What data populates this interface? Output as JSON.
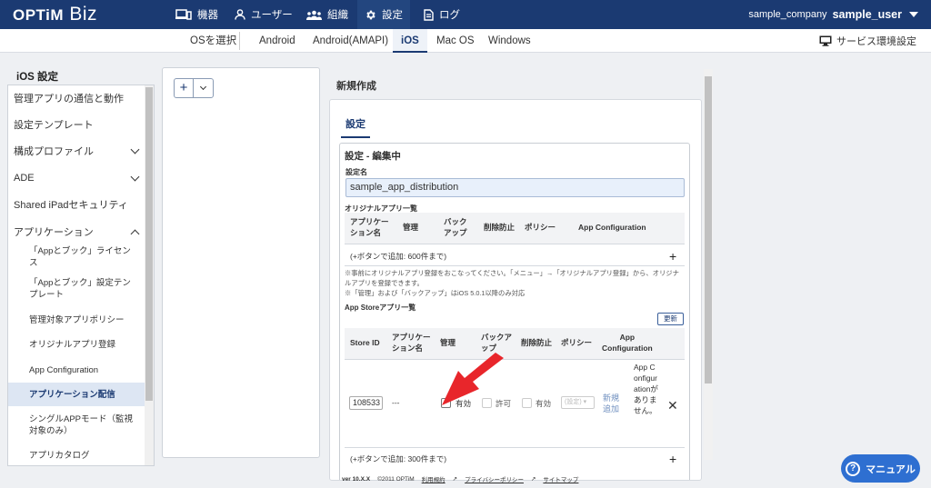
{
  "brand": {
    "logo_main": "OPTiM",
    "logo_sub": "Biz"
  },
  "topnav": [
    {
      "label": "機器",
      "icon": "device-icon"
    },
    {
      "label": "ユーザー",
      "icon": "user-icon"
    },
    {
      "label": "組織",
      "icon": "group-icon"
    },
    {
      "label": "設定",
      "icon": "gear-icon",
      "active": true
    },
    {
      "label": "ログ",
      "icon": "log-icon"
    }
  ],
  "account": {
    "company": "sample_company",
    "user": "sample_user"
  },
  "osbar": {
    "select_label": "OSを選択",
    "tabs": [
      "Android",
      "Android(AMAPI)",
      "iOS",
      "Mac OS",
      "Windows"
    ],
    "active_tab": "iOS",
    "service_settings": "サービス環境設定"
  },
  "sidebar": {
    "title": "iOS 設定",
    "items": [
      {
        "label": "管理アプリの通信と動作"
      },
      {
        "label": "設定テンプレート"
      },
      {
        "label": "構成プロファイル",
        "chevron": "down"
      },
      {
        "label": "ADE",
        "chevron": "down"
      },
      {
        "label": "Shared iPadセキュリティ"
      },
      {
        "label": "アプリケーション",
        "chevron": "up"
      },
      {
        "label": "「Appとブック」ライセンス"
      },
      {
        "label": "「Appとブック」設定テンプレート"
      },
      {
        "label": "管理対象アプリポリシー"
      },
      {
        "label": "オリジナルアプリ登録"
      },
      {
        "label": "App Configuration"
      },
      {
        "label": "アプリケーション配信",
        "active": true
      },
      {
        "label": "シングルAPPモード（監視対象のみ）"
      },
      {
        "label": "アプリカタログ"
      }
    ]
  },
  "middle": {
    "add_symbol": "+"
  },
  "main": {
    "new_title": "新規作成",
    "tab": "設定",
    "edit_title": "設定 - 編集中",
    "name_label": "設定名",
    "name_value": "sample_app_distribution",
    "original": {
      "title": "オリジナルアプリ一覧",
      "headers": [
        "アプリケー\nション名",
        "管理",
        "バック\nアップ",
        "削除防止",
        "ポリシー",
        "App Configuration"
      ],
      "add_hint": "(+ボタンで追加: 600件まで)",
      "note1": "※事前にオリジナルアプリ登録をおこなってください。「メニュー」→「オリジナルアプリ登録」から、オリジナルアプリを登録できます。",
      "note2": "※「管理」および「バックアップ」はiOS 5.0.1以降のみ対応"
    },
    "appstore": {
      "title": "App Storeアプリ一覧",
      "update_btn": "更新",
      "headers": [
        "Store ID",
        "アプリケー\nション名",
        "管理",
        "バックア\nップ",
        "削除防止",
        "ポリシー",
        "App\nConfiguration"
      ],
      "row": {
        "store_id": "108533",
        "app_name": "---",
        "manage_label": "有効",
        "backup_label": "許可",
        "delete_label": "有効",
        "policy_select": "(設定)",
        "policy_link": "新規\n追加",
        "app_config": "App Configurationがありません。"
      },
      "add_hint": "(+ボタンで追加: 300件まで)"
    }
  },
  "footer": {
    "version": "ver 10.X.X",
    "copyright": "©2011 OPTiM",
    "links": [
      "利用規約",
      "プライバシーポリシー",
      "サイトマップ"
    ]
  },
  "manual_button": "マニュアル",
  "colors": {
    "header": "#1b3a72",
    "arrow": "#e8262b",
    "manual": "#2e6fd1"
  }
}
